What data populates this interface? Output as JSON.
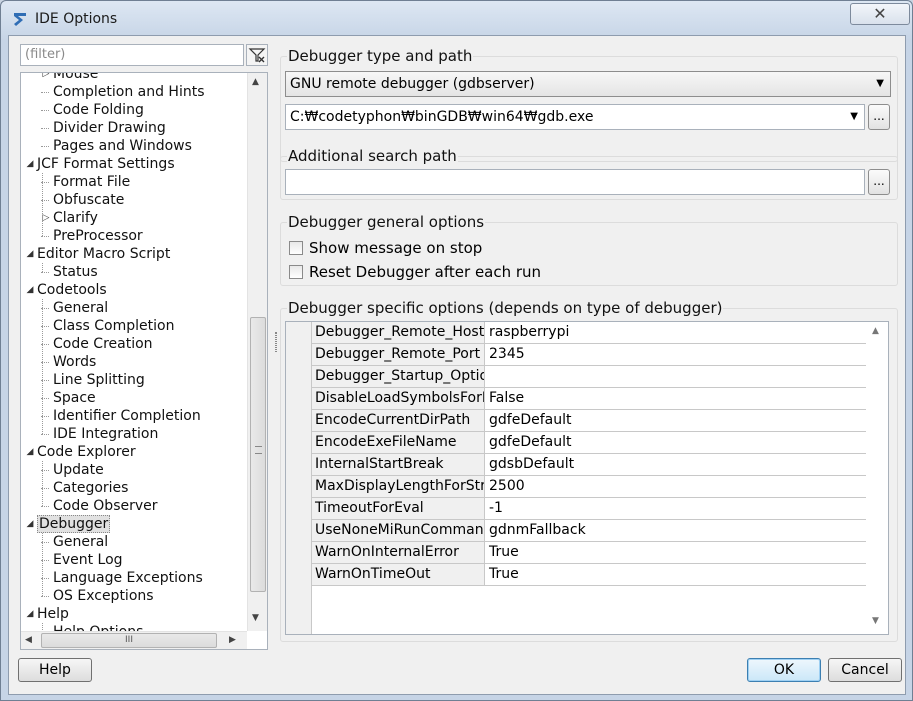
{
  "window": {
    "title": "IDE Options",
    "close_label": "✕"
  },
  "sidebar": {
    "filter_placeholder": "(filter)",
    "items": [
      {
        "label": "Mouse",
        "level": 1,
        "toggle": "collapsed"
      },
      {
        "label": "Completion and Hints",
        "level": 1
      },
      {
        "label": "Code Folding",
        "level": 1
      },
      {
        "label": "Divider Drawing",
        "level": 1
      },
      {
        "label": "Pages and Windows",
        "level": 1
      },
      {
        "label": "JCF Format Settings",
        "level": 0,
        "toggle": "expanded"
      },
      {
        "label": "Format File",
        "level": 1
      },
      {
        "label": "Obfuscate",
        "level": 1
      },
      {
        "label": "Clarify",
        "level": 1,
        "toggle": "collapsed"
      },
      {
        "label": "PreProcessor",
        "level": 1
      },
      {
        "label": "Editor Macro Script",
        "level": 0,
        "toggle": "expanded"
      },
      {
        "label": "Status",
        "level": 1
      },
      {
        "label": "Codetools",
        "level": 0,
        "toggle": "expanded"
      },
      {
        "label": "General",
        "level": 1
      },
      {
        "label": "Class Completion",
        "level": 1
      },
      {
        "label": "Code Creation",
        "level": 1
      },
      {
        "label": "Words",
        "level": 1
      },
      {
        "label": "Line Splitting",
        "level": 1
      },
      {
        "label": "Space",
        "level": 1
      },
      {
        "label": "Identifier Completion",
        "level": 1
      },
      {
        "label": "IDE Integration",
        "level": 1
      },
      {
        "label": "Code Explorer",
        "level": 0,
        "toggle": "expanded"
      },
      {
        "label": "Update",
        "level": 1
      },
      {
        "label": "Categories",
        "level": 1
      },
      {
        "label": "Code Observer",
        "level": 1
      },
      {
        "label": "Debugger",
        "level": 0,
        "toggle": "expanded",
        "selected": true
      },
      {
        "label": "General",
        "level": 1
      },
      {
        "label": "Event Log",
        "level": 1
      },
      {
        "label": "Language Exceptions",
        "level": 1
      },
      {
        "label": "OS Exceptions",
        "level": 1
      },
      {
        "label": "Help",
        "level": 0,
        "toggle": "expanded"
      },
      {
        "label": "Help Options",
        "level": 1
      }
    ],
    "hscroll_grip": "III"
  },
  "debugger_type": {
    "title": "Debugger type and path",
    "type_value": "GNU remote debugger (gdbserver)",
    "path_value": "C:₩codetyphon₩binGDB₩win64₩gdb.exe",
    "browse_label": "..."
  },
  "search_path": {
    "title": "Additional search path",
    "value": "",
    "browse_label": "..."
  },
  "general_options": {
    "title": "Debugger general options",
    "show_message_on_stop": "Show message on stop",
    "reset_after_run": "Reset Debugger after each run"
  },
  "specific_options": {
    "title": "Debugger specific options (depends on type of debugger)",
    "rows": [
      {
        "name": "Debugger_Remote_Hostname",
        "value": "raspberrypi"
      },
      {
        "name": "Debugger_Remote_Port",
        "value": "2345"
      },
      {
        "name": "Debugger_Startup_Options",
        "value": ""
      },
      {
        "name": "DisableLoadSymbolsForLibraries",
        "value": "False"
      },
      {
        "name": "EncodeCurrentDirPath",
        "value": "gdfeDefault"
      },
      {
        "name": "EncodeExeFileName",
        "value": "gdfeDefault"
      },
      {
        "name": "InternalStartBreak",
        "value": "gdsbDefault"
      },
      {
        "name": "MaxDisplayLengthForString",
        "value": "2500"
      },
      {
        "name": "TimeoutForEval",
        "value": "-1"
      },
      {
        "name": "UseNoneMiRunCommands",
        "value": "gdnmFallback"
      },
      {
        "name": "WarnOnInternalError",
        "value": "True"
      },
      {
        "name": "WarnOnTimeOut",
        "value": "True"
      }
    ]
  },
  "buttons": {
    "help": "Help",
    "ok": "OK",
    "cancel": "Cancel"
  }
}
